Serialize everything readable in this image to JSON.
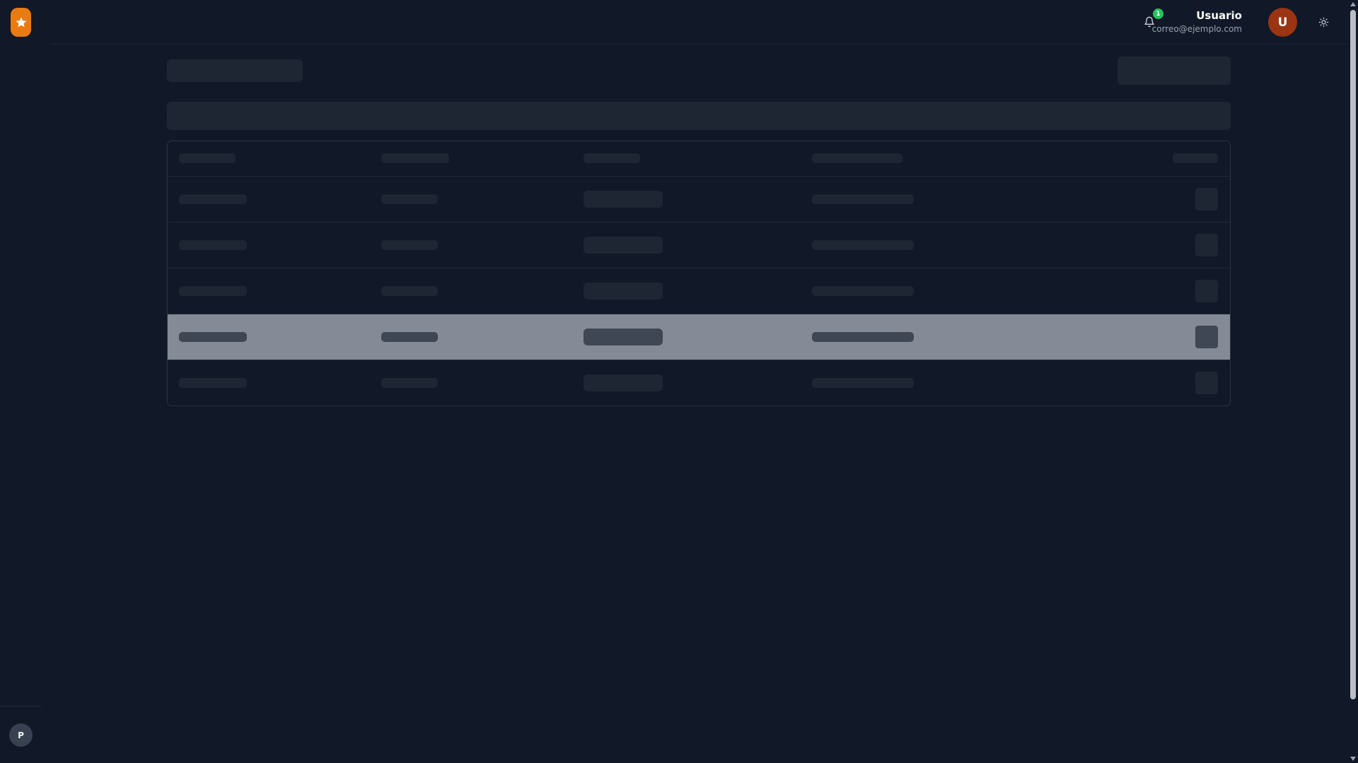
{
  "sidebar": {
    "logo_icon": "star-icon",
    "project_avatar_initial": "P"
  },
  "header": {
    "notifications": {
      "icon": "bell-icon",
      "count": "1"
    },
    "user": {
      "name": "Usuario",
      "email": "correo@ejemplo.com",
      "avatar_initial": "U"
    },
    "theme_toggle_icon": "sun-icon"
  },
  "colors": {
    "background": "#111827",
    "accent": "#ea7b10",
    "notification_badge": "#22c55e",
    "avatar": "#9a3412",
    "skeleton": "#1e2633",
    "row_highlight": "#848b96"
  }
}
